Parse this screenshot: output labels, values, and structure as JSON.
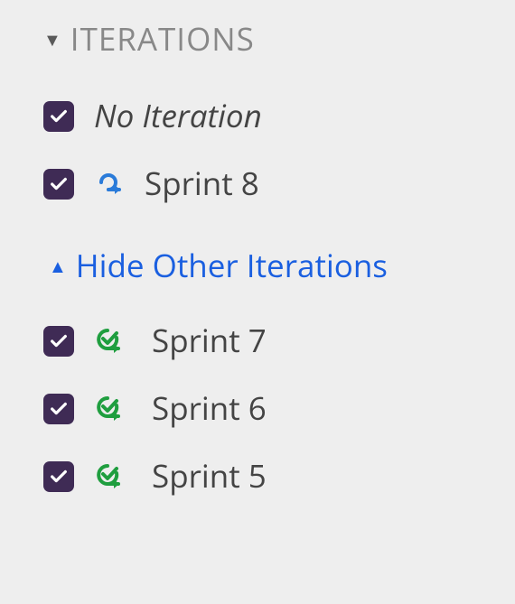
{
  "section": {
    "title": "ITERATIONS"
  },
  "items_primary": [
    {
      "checked": true,
      "status": "none",
      "label": "No Iteration",
      "italic": true,
      "name": "no-iteration"
    },
    {
      "checked": true,
      "status": "active",
      "label": "Sprint 8",
      "italic": false,
      "name": "sprint-8"
    }
  ],
  "toggle": {
    "label": "Hide Other Iterations"
  },
  "items_other": [
    {
      "checked": true,
      "status": "done",
      "label": "Sprint 7",
      "name": "sprint-7"
    },
    {
      "checked": true,
      "status": "done",
      "label": "Sprint 6",
      "name": "sprint-6"
    },
    {
      "checked": true,
      "status": "done",
      "label": "Sprint 5",
      "name": "sprint-5"
    }
  ],
  "colors": {
    "checkbox_bg": "#3f2b55",
    "active_icon": "#2a7bd9",
    "done_icon": "#1f9e3f",
    "link": "#1a5fe0",
    "muted": "#888"
  }
}
